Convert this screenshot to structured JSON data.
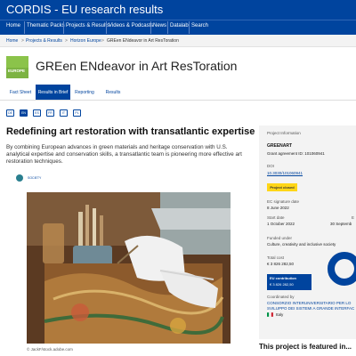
{
  "site": {
    "title": "CORDIS - EU research results"
  },
  "nav": {
    "items": [
      "Home",
      "Thematic Packs",
      "Projects & Results",
      "Videos & Podcasts",
      "News",
      "Datalab",
      "Search"
    ]
  },
  "breadcrumb": {
    "items": [
      "Home",
      "Projects & Results",
      "Horizon Europe",
      "GREen ENdeavor in Art ResToration"
    ],
    "separator": ">"
  },
  "project": {
    "logo_text": "EUROPE",
    "title": "GREen ENdeavor in Art ResToration"
  },
  "tabs": {
    "items": [
      "Fact Sheet",
      "Results in Brief",
      "Reporting",
      "Results"
    ],
    "active_index": 1
  },
  "languages": {
    "items": [
      "DE",
      "EN",
      "ES",
      "FR",
      "IT",
      "PL"
    ],
    "active_index": 1
  },
  "article": {
    "title": "Redefining art restoration with transatlantic expertise",
    "lead": "By combining European advances in green materials and heritage conservation with U.S. analytical expertise and conservation skills, a transatlantic team is pioneering more effective art restoration techniques.",
    "tag": "SOCIETY",
    "image_credit": "© JackF/stock.adobe.com"
  },
  "project_info": {
    "heading": "Project Information",
    "acronym": "GREENART",
    "grant_label": "Grant agreement ID: 101060941",
    "doi_label": "DOI",
    "doi_value": "10.3030/101060941",
    "status": "Project closed",
    "ec_signature_label": "EC signature date",
    "ec_signature_value": "8 June 2022",
    "start_label": "Start date",
    "start_value": "1 October 2022",
    "end_label": "E",
    "end_value": "30 Septemb",
    "funded_under_label": "Funded under",
    "funded_under_value": "Culture, creativity and inclusive society",
    "total_cost_label": "Total cost",
    "total_cost_value": "€ 3 826 282,50",
    "eu_contribution_label": "EU contribution",
    "eu_contribution_value": "€ 3 826 282,50",
    "coordinated_label": "Coordinated by",
    "coordinator_line1": "CONSORZIO INTERUNIVERSITARIO PER LO",
    "coordinator_line2": "SVILUPPO DEI SISTEMI A GRANDE INTERFAC",
    "country": "Italy",
    "funding_share": 1.0
  },
  "featured": {
    "text": "This project is featured in..."
  },
  "colors": {
    "brand_blue": "#00449e",
    "status_yellow": "#ffd617",
    "logo_green": "#7cb342"
  },
  "icons": {
    "tag": "society-icon",
    "flag": "italy-flag-icon"
  }
}
